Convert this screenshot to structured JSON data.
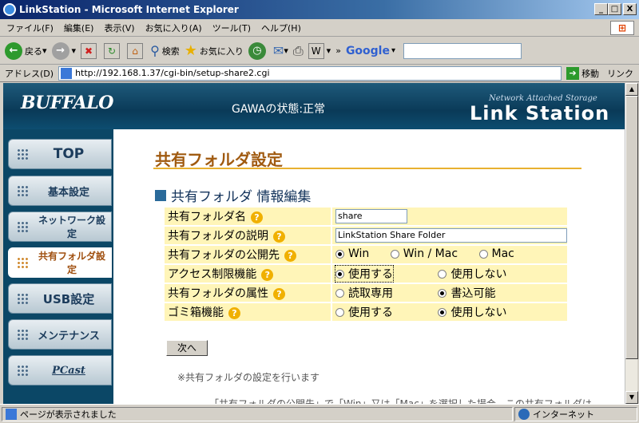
{
  "window": {
    "title": "LinkStation - Microsoft Internet Explorer",
    "minimize": "_",
    "maximize": "□",
    "close": "X"
  },
  "menu": [
    "ファイル(F)",
    "編集(E)",
    "表示(V)",
    "お気に入り(A)",
    "ツール(T)",
    "ヘルプ(H)"
  ],
  "toolbar": {
    "back": "戻る",
    "search": "検索",
    "favorites": "お気に入り",
    "google": "Google",
    "chevron": "»"
  },
  "address": {
    "label": "アドレス(D)",
    "url": "http://192.168.1.37/cgi-bin/setup-share2.cgi",
    "go": "移動",
    "links": "リンク"
  },
  "header": {
    "logo": "BUFFALO",
    "status": "GAWAの状態:正常",
    "nas_label": "Network Attached Storage",
    "product": "Link Station"
  },
  "nav": [
    {
      "label": "TOP",
      "active": false
    },
    {
      "label": "基本設定",
      "active": false
    },
    {
      "label": "ネットワーク設定",
      "active": false
    },
    {
      "label": "共有フォルダ設定",
      "active": true
    },
    {
      "label": "USB設定",
      "active": false
    },
    {
      "label": "メンテナンス",
      "active": false
    },
    {
      "label": "PCast",
      "active": false
    }
  ],
  "main": {
    "title": "共有フォルダ設定",
    "section": "共有フォルダ 情報編集",
    "fields": {
      "name_label": "共有フォルダ名",
      "name_value": "share",
      "desc_label": "共有フォルダの説明",
      "desc_value": "LinkStation Share Folder",
      "pub_label": "共有フォルダの公開先",
      "pub_opt1": "Win",
      "pub_opt2": "Win / Mac",
      "pub_opt3": "Mac",
      "acl_label": "アクセス制限機能",
      "acl_opt1": "使用する",
      "acl_opt2": "使用しない",
      "attr_label": "共有フォルダの属性",
      "attr_opt1": "読取専用",
      "attr_opt2": "書込可能",
      "trash_label": "ゴミ箱機能",
      "trash_opt1": "使用する",
      "trash_opt2": "使用しない"
    },
    "help_icon": "?",
    "next_button": "次へ",
    "note": "※共有フォルダの設定を行います",
    "note2": "「共有フォルダの公開先」で「Win」又は「Mac」を選択した場合、この共有フォルダは"
  },
  "statusbar": {
    "text": "ページが表示されました",
    "zone": "インターネット"
  }
}
